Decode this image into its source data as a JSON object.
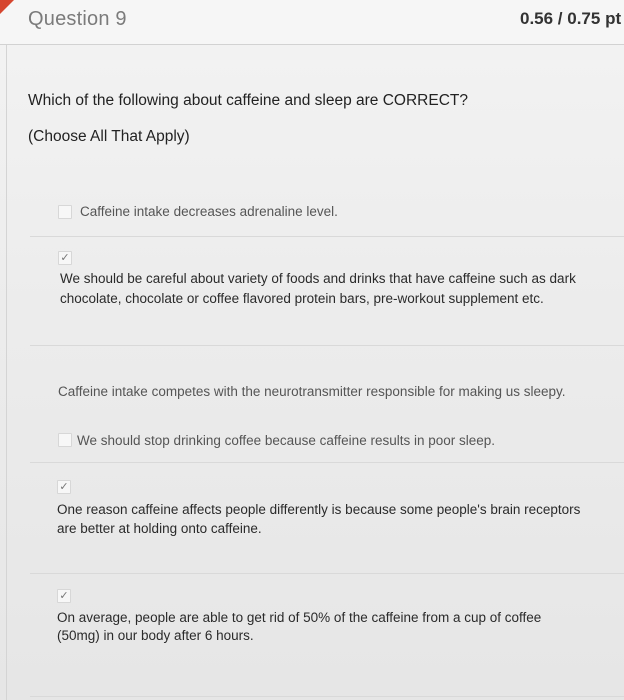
{
  "header": {
    "title": "Question 9",
    "score": "0.56 / 0.75 pt"
  },
  "question": {
    "prompt": "Which of the following about caffeine and sleep are CORRECT?",
    "instruction": "(Choose All That Apply)"
  },
  "options": [
    {
      "text": "Caffeine intake decreases adrenaline level.",
      "checked": false,
      "checkmark": ""
    },
    {
      "text_line1": "We should be careful about variety of foods and drinks that have caffeine such as dark",
      "text_line2": "chocolate, chocolate or coffee flavored protein bars, pre-workout supplement etc.",
      "checked": true,
      "checkmark": "✓"
    },
    {
      "text": "Caffeine intake competes with the neurotransmitter responsible for making us sleepy.",
      "checked": false,
      "checkmark": ""
    },
    {
      "text": "We should stop drinking coffee because caffeine results in poor sleep.",
      "checked": false,
      "checkmark": ""
    },
    {
      "text_line1": "One reason caffeine affects people differently is because some people's brain receptors",
      "text_line2": "are better at holding onto caffeine.",
      "checked": true,
      "checkmark": "✓"
    },
    {
      "text_line1": "On average, people are able to get rid of 50% of the caffeine from a cup of coffee",
      "text_line2": "(50mg) in our body after 6 hours.",
      "checked": true,
      "checkmark": "✓"
    }
  ],
  "colors": {
    "flag": "#d6462f",
    "header_bg": "#f6f6f6",
    "page_bg": "#ececec"
  }
}
